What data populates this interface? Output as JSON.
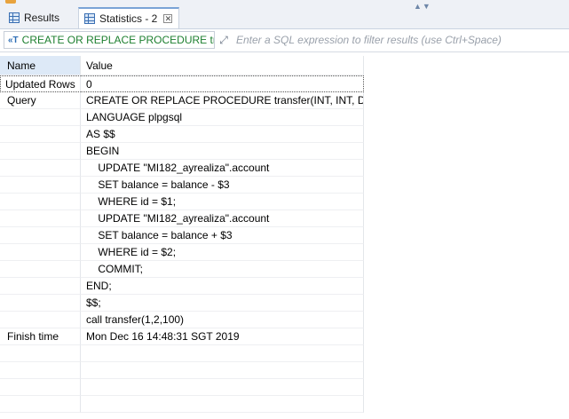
{
  "tabs": [
    {
      "label": "Results",
      "icon": "grid-icon",
      "active": false
    },
    {
      "label": "Statistics - 2",
      "icon": "grid-icon",
      "active": true
    }
  ],
  "filter": {
    "query_label": "CREATE OR REPLACE PROCEDURE trans",
    "placeholder": "Enter a SQL expression to filter results (use Ctrl+Space)"
  },
  "grid": {
    "columns": [
      "Name",
      "Value"
    ],
    "rows": [
      {
        "name": "Updated Rows",
        "value": "0"
      },
      {
        "name": "Query",
        "value": "CREATE OR REPLACE PROCEDURE transfer(INT, INT, DEC)"
      },
      {
        "name": "",
        "value": "LANGUAGE plpgsql"
      },
      {
        "name": "",
        "value": "AS $$"
      },
      {
        "name": "",
        "value": "BEGIN"
      },
      {
        "name": "",
        "value": "    UPDATE \"MI182_ayrealiza\".account"
      },
      {
        "name": "",
        "value": "    SET balance = balance - $3"
      },
      {
        "name": "",
        "value": "    WHERE id = $1;"
      },
      {
        "name": "",
        "value": "    UPDATE \"MI182_ayrealiza\".account"
      },
      {
        "name": "",
        "value": "    SET balance = balance + $3"
      },
      {
        "name": "",
        "value": "    WHERE id = $2;"
      },
      {
        "name": "",
        "value": "    COMMIT;"
      },
      {
        "name": "",
        "value": "END;"
      },
      {
        "name": "",
        "value": "$$;"
      },
      {
        "name": "",
        "value": "call transfer(1,2,100)"
      },
      {
        "name": "Finish time",
        "value": "Mon Dec 16 14:48:31 SGT 2019"
      },
      {
        "name": "",
        "value": ""
      },
      {
        "name": "",
        "value": ""
      },
      {
        "name": "",
        "value": ""
      },
      {
        "name": "",
        "value": ""
      }
    ]
  },
  "colors": {
    "accent": "#3a6fb3",
    "query_text": "#1d7f2f",
    "header_highlight": "#dde9f7"
  }
}
